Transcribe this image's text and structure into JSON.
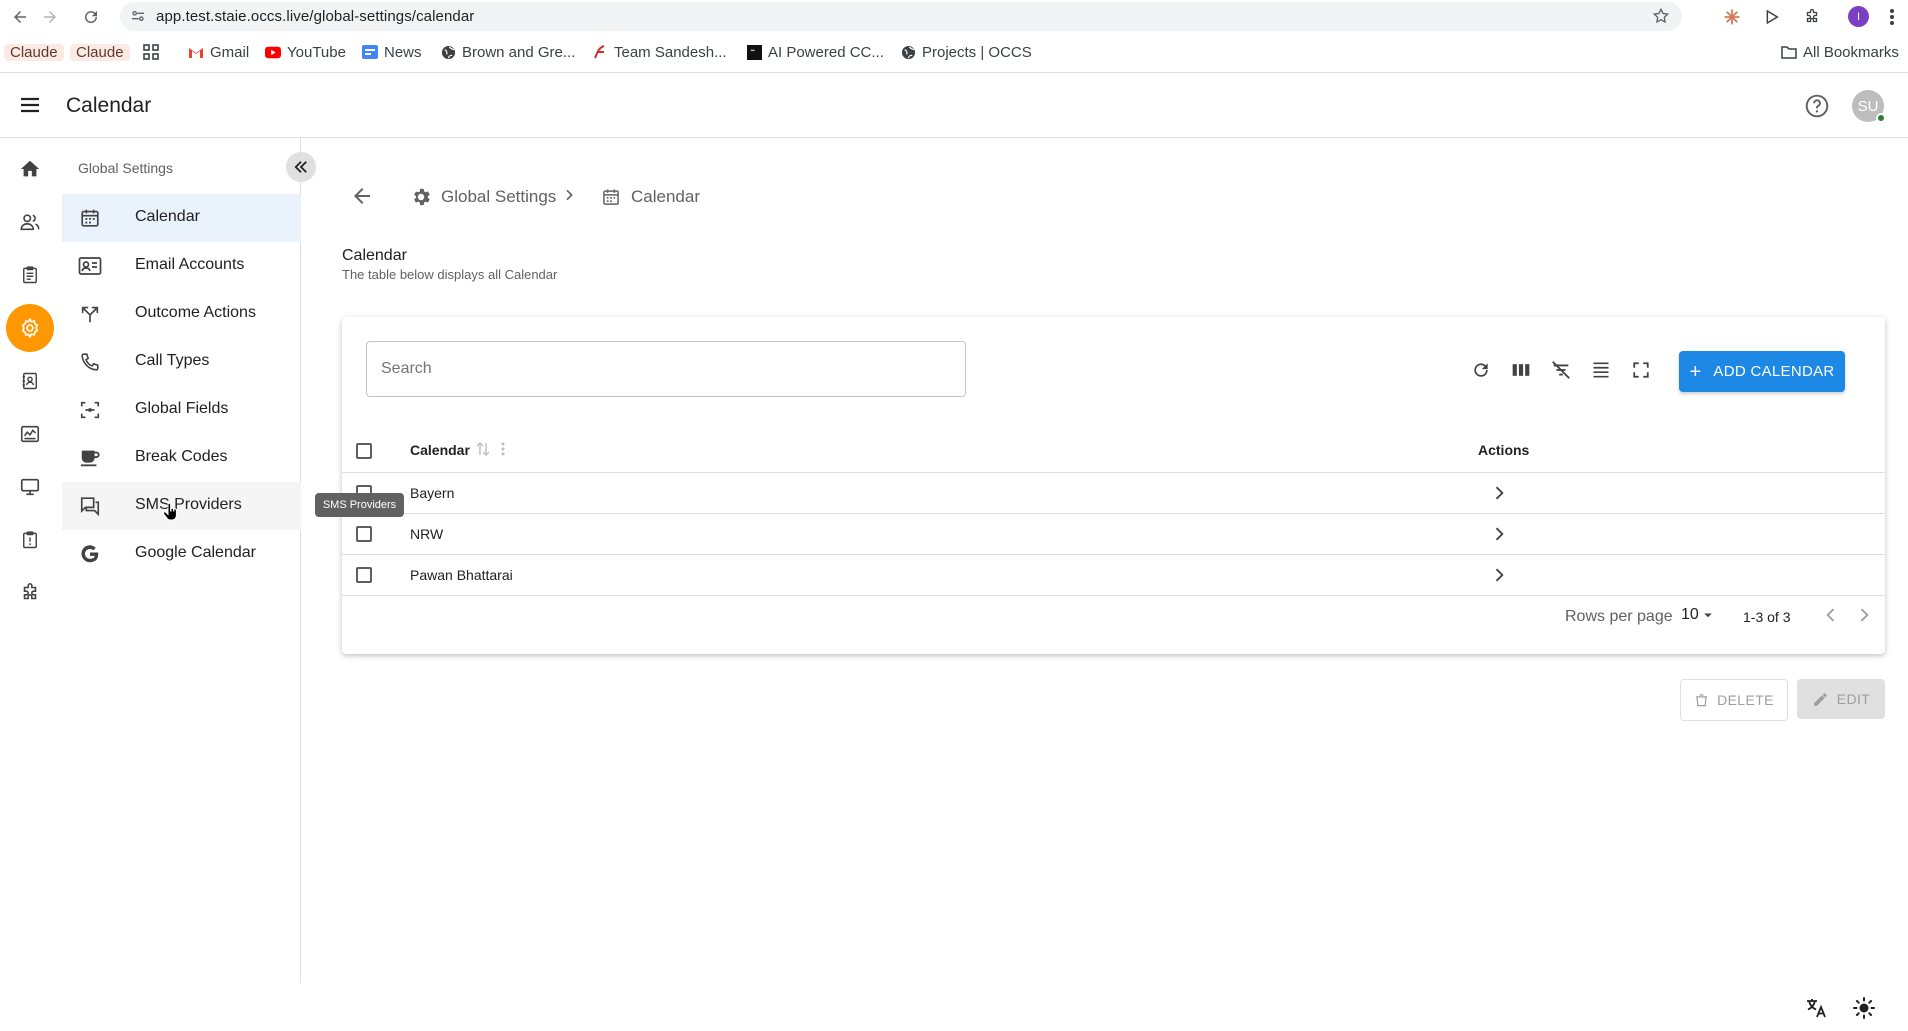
{
  "browser": {
    "url": "app.test.staie.occs.live/global-settings/calendar",
    "profile_initial": "I",
    "bookmarks": [
      {
        "label": "Claude",
        "icon": "claude-chip"
      },
      {
        "label": "Claude",
        "icon": "claude-chip"
      },
      {
        "label": "",
        "icon": "apps-grid-icon"
      },
      {
        "label": "Gmail",
        "icon": "gmail-icon"
      },
      {
        "label": "YouTube",
        "icon": "youtube-icon"
      },
      {
        "label": "News",
        "icon": "news-icon"
      },
      {
        "label": "Brown and Gre...",
        "icon": "globe-icon"
      },
      {
        "label": "Team Sandesh...",
        "icon": "team-icon"
      },
      {
        "label": "AI Powered CC...",
        "icon": "black-square-icon"
      },
      {
        "label": "Projects | OCCS",
        "icon": "globe-icon"
      }
    ],
    "all_bookmarks": "All Bookmarks"
  },
  "header": {
    "title": "Calendar",
    "avatar_initials": "SU"
  },
  "sidebar": {
    "title": "Global Settings",
    "items": [
      {
        "label": "Calendar",
        "icon": "calendar-icon"
      },
      {
        "label": "Email Accounts",
        "icon": "contact-card-icon"
      },
      {
        "label": "Outcome Actions",
        "icon": "fork-icon"
      },
      {
        "label": "Call Types",
        "icon": "phone-icon"
      },
      {
        "label": "Global Fields",
        "icon": "center-focus-icon"
      },
      {
        "label": "Break Codes",
        "icon": "coffee-icon"
      },
      {
        "label": "SMS Providers",
        "icon": "chat-icon"
      },
      {
        "label": "Google Calendar",
        "icon": "google-icon"
      }
    ],
    "tooltip": "SMS Providers"
  },
  "breadcrumb": {
    "parent": "Global Settings",
    "current": "Calendar"
  },
  "section": {
    "title": "Calendar",
    "subtitle": "The table below displays all Calendar"
  },
  "table": {
    "search_placeholder": "Search",
    "add_button": "ADD CALENDAR",
    "columns": {
      "calendar": "Calendar",
      "actions": "Actions"
    },
    "rows": [
      {
        "name": "Bayern"
      },
      {
        "name": "NRW"
      },
      {
        "name": "Pawan Bhattarai"
      }
    ],
    "rows_per_page_label": "Rows per page",
    "rows_per_page": "10",
    "range": "1-3 of 3"
  },
  "actions": {
    "delete": "DELETE",
    "edit": "EDIT"
  },
  "colors": {
    "accent": "#1e88e5",
    "active_rail": "#ff9800",
    "active_row": "#eaf2fb"
  }
}
